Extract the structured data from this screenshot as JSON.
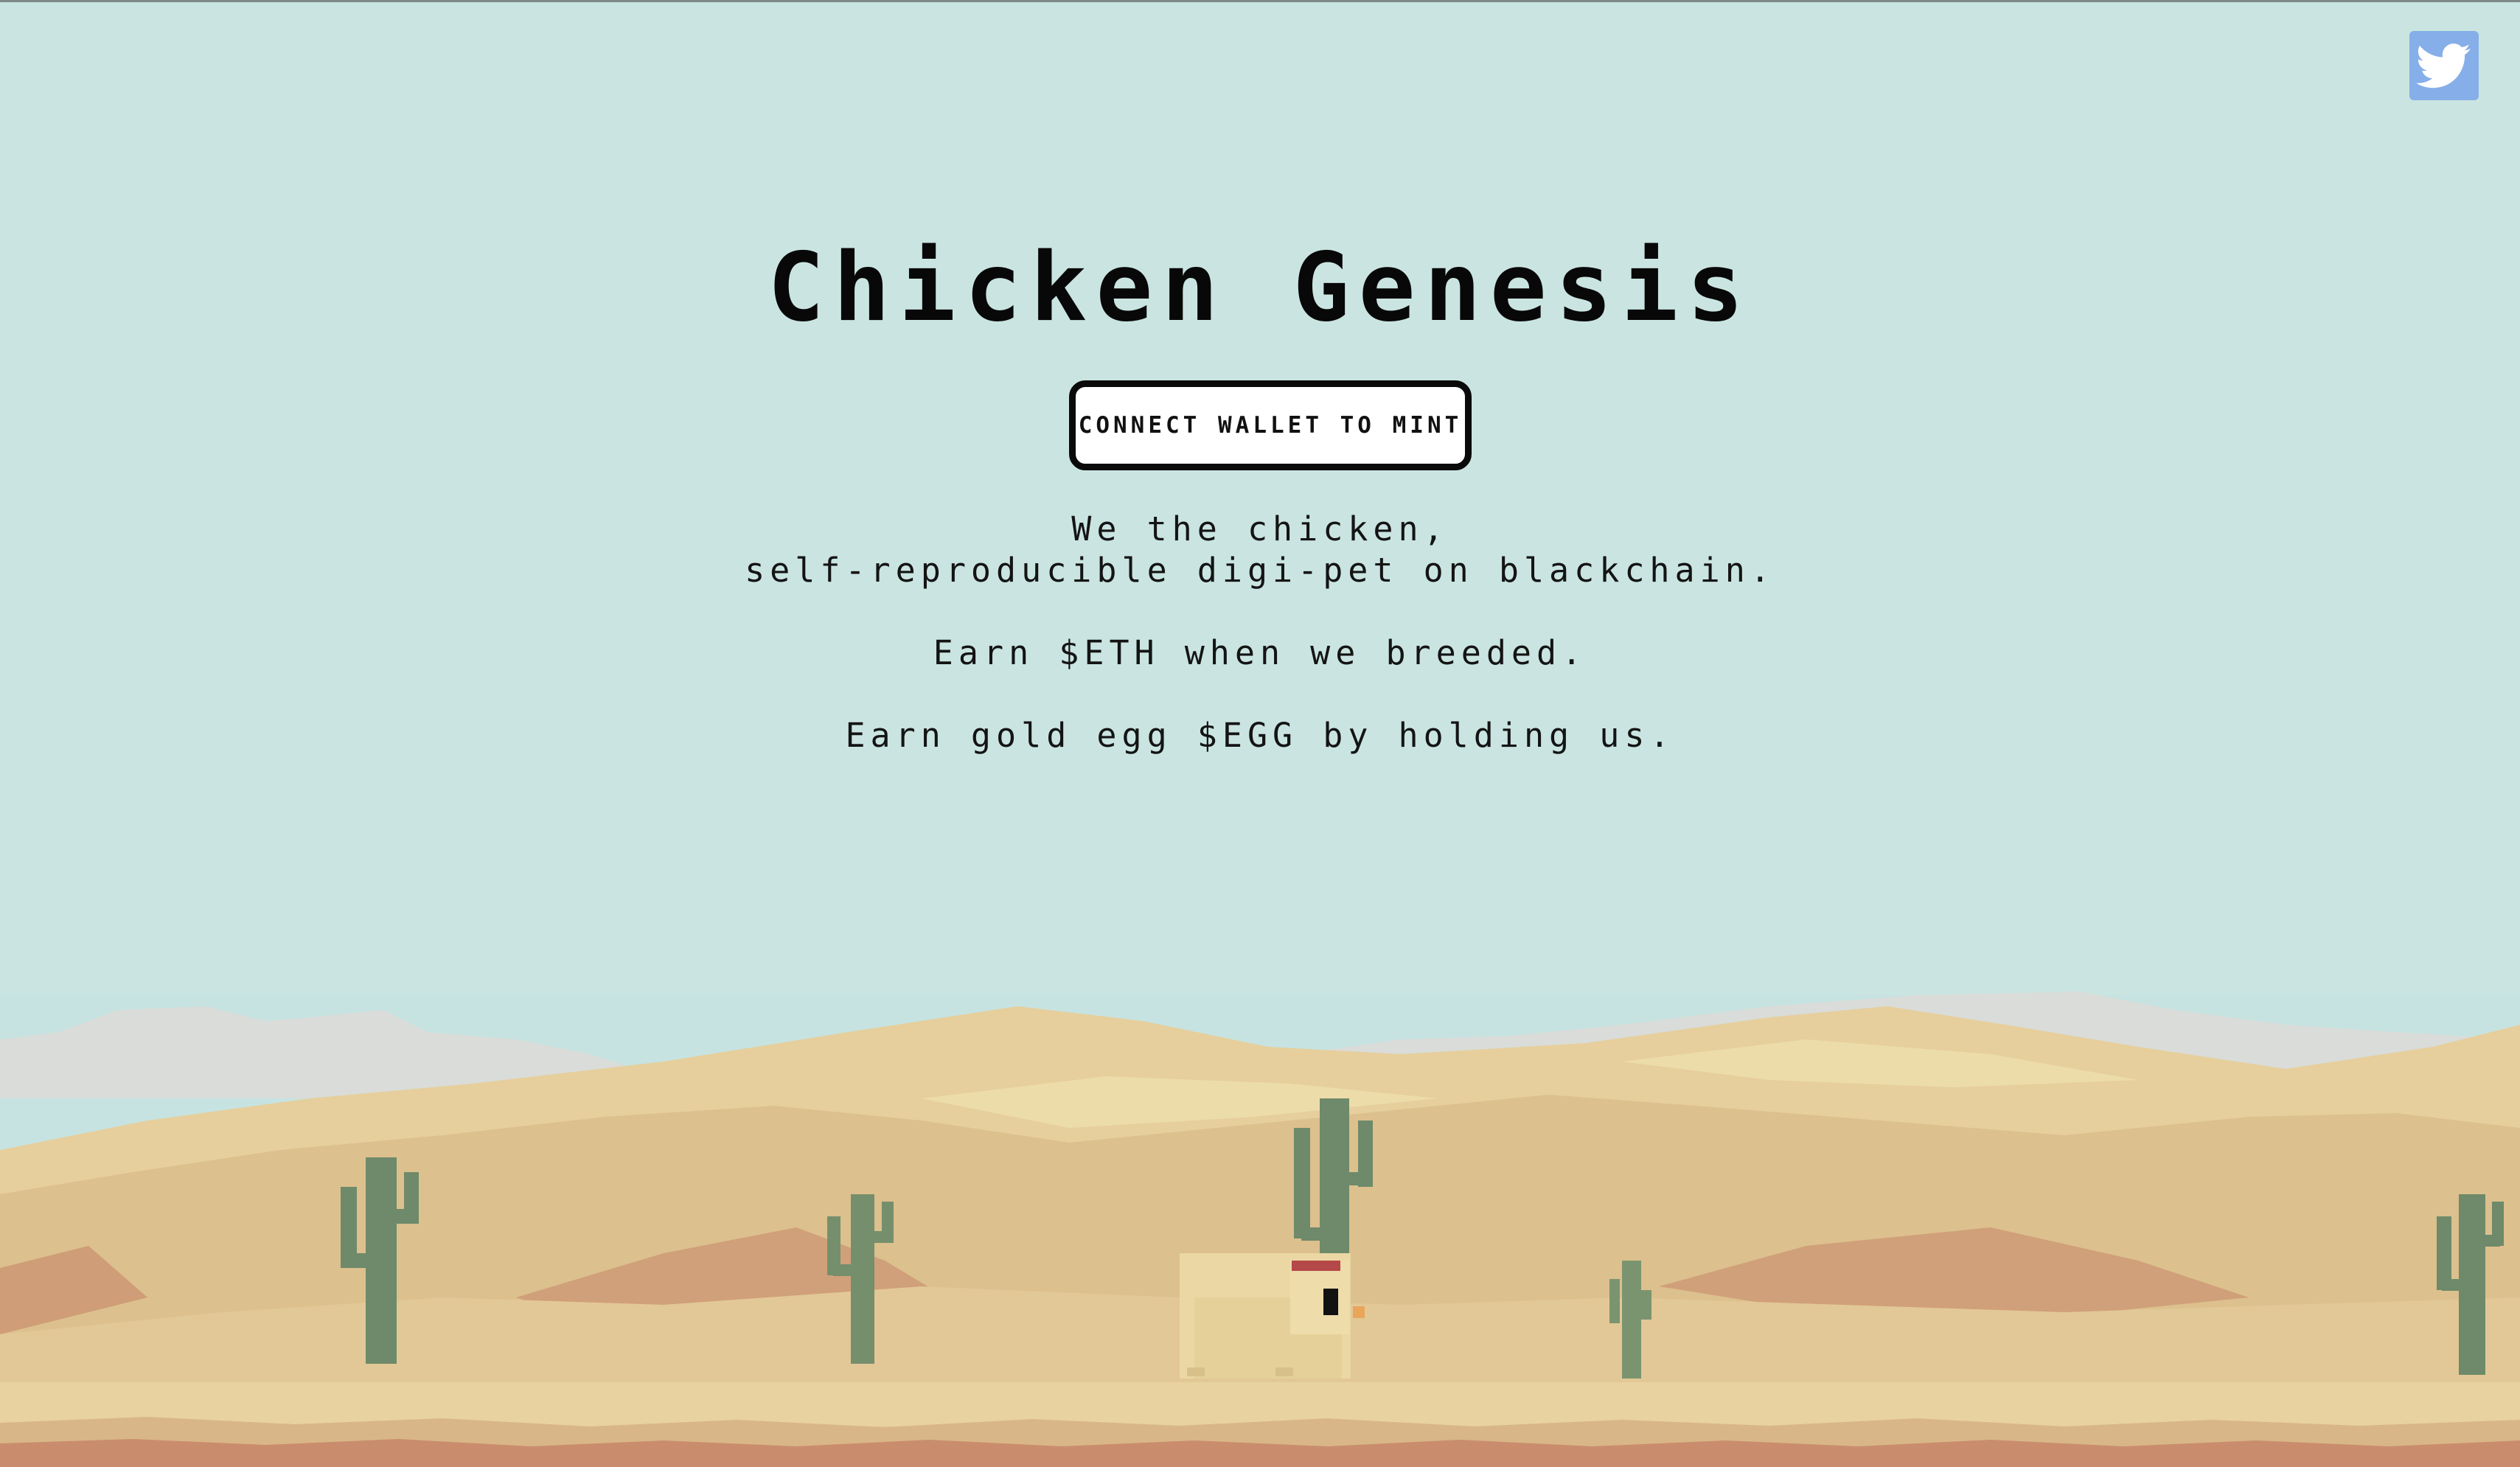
{
  "page": {
    "title": "Chicken Genesis",
    "mint_button": "CONNECT WALLET TO MINT",
    "tagline": [
      "We the chicken,",
      "self-reproducible digi-pet on blackchain."
    ],
    "lines": [
      "Earn $ETH when we breeded.",
      "Earn gold egg $EGG by holding us."
    ]
  },
  "social": {
    "twitter_icon": "twitter-bird-icon"
  },
  "colors": {
    "sky": "#cae5e1",
    "twitter_bg": "#86aee8",
    "button_border": "#0a0a0a",
    "sand_light": "#ecd9a6",
    "sand_mid": "#dfc291",
    "sand_dark": "#d5a47c",
    "ground_band": "#c98d6d",
    "cactus": "#6e8a6a"
  }
}
